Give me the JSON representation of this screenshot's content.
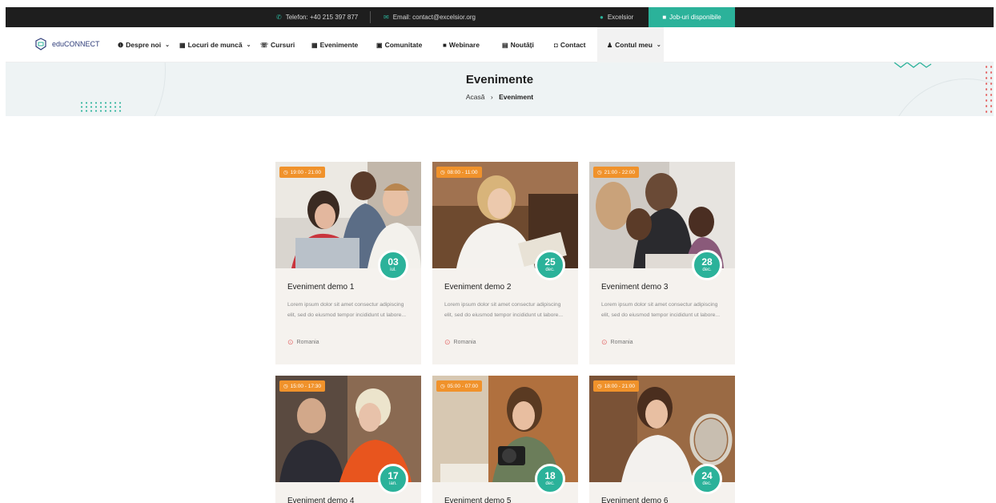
{
  "topbar": {
    "phone": "Telefon: +40 215 397 877",
    "email": "Email: contact@excelsior.org",
    "user": "Excelsior",
    "jobs_button": "Job-uri disponibile"
  },
  "logo": {
    "text": "eduCONNECT"
  },
  "nav": {
    "items": [
      {
        "label": "Despre noi",
        "icon": "info-icon",
        "dropdown": true
      },
      {
        "label": "Locuri de muncă",
        "icon": "briefcase-icon",
        "dropdown": true
      },
      {
        "label": "Cursuri",
        "icon": "chat-icon"
      },
      {
        "label": "Evenimente",
        "icon": "calendar-icon"
      },
      {
        "label": "Comunitate",
        "icon": "community-icon"
      },
      {
        "label": "Webinare",
        "icon": "video-icon"
      },
      {
        "label": "Noutăți",
        "icon": "news-icon"
      },
      {
        "label": "Contact",
        "icon": "inbox-icon"
      },
      {
        "label": "Contul meu",
        "icon": "users-icon",
        "dropdown": true
      }
    ]
  },
  "banner": {
    "title": "Evenimente",
    "breadcrumb_home": "Acasă",
    "breadcrumb_sep": "›",
    "breadcrumb_current": "Eveniment"
  },
  "events": [
    {
      "time": "19:00 - 21:00",
      "day": "03",
      "month": "iul.",
      "title": "Eveniment demo 1",
      "desc": "Lorem ipsum dolor sit amet consectur adipiscing elit, sed do eiusmod tempor incididunt ut labore...",
      "location": "Romania"
    },
    {
      "time": "08:00 - 11:00",
      "day": "25",
      "month": "dec.",
      "title": "Eveniment demo 2",
      "desc": "Lorem ipsum dolor sit amet consectur adipiscing elit, sed do eiusmod tempor incididunt ut labore...",
      "location": "Romania"
    },
    {
      "time": "21:00 - 22:00",
      "day": "28",
      "month": "dec.",
      "title": "Eveniment demo 3",
      "desc": "Lorem ipsum dolor sit amet consectur adipiscing elit, sed do eiusmod tempor incididunt ut labore...",
      "location": "Romania"
    },
    {
      "time": "15:00 - 17:30",
      "day": "17",
      "month": "ian.",
      "title": "Eveniment demo 4"
    },
    {
      "time": "05:00 - 07:00",
      "day": "18",
      "month": "dec.",
      "title": "Eveniment demo 5"
    },
    {
      "time": "18:00 - 21:00",
      "day": "24",
      "month": "dec.",
      "title": "Eveniment demo 6"
    }
  ],
  "colors": {
    "accent": "#2bb29a",
    "time_badge": "#f0922b",
    "topbar_bg": "#1e1e1e",
    "card_bg": "#f5f2ee"
  }
}
